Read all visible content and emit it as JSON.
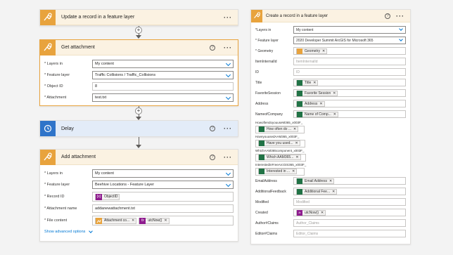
{
  "update_card": {
    "title": "Update a record in a feature layer"
  },
  "get_card": {
    "title": "Get attachment",
    "fields": [
      {
        "label": "* Layers in",
        "value": "My content"
      },
      {
        "label": "* Feature layer",
        "value": "Traffic Collisions / Traffic_Collisions"
      },
      {
        "label": "* Object ID",
        "value": "8"
      },
      {
        "label": "* Attachment",
        "value": "test.txt"
      }
    ]
  },
  "delay_card": {
    "title": "Delay"
  },
  "add_card": {
    "title": "Add attachment",
    "layers_label": "* Layers in",
    "layers_value": "My content",
    "feature_label": "* Feature layer",
    "feature_value": "Beehive Locations - Feature Layer",
    "record_label": "* Record ID",
    "record_token": "ObjectID",
    "name_label": "* Attachment name",
    "name_value": "addanewattachment.txt",
    "content_label": "* File content",
    "content_token1": "Attachment co...",
    "content_token2": "utcNow()",
    "advanced": "Show advanced options"
  },
  "create_card": {
    "title": "Create a record in a feature layer",
    "layers_label": "*Layers in",
    "layers_value": "My content",
    "feature_label": "* Feature layer",
    "feature_value": "2020 Developer Summit ArcGIS for Microsoft 365",
    "geometry_label": "* Geometry",
    "geometry_token": "Geometry",
    "itemid_label": "ItemInternalId",
    "itemid_ph": "ItemInternalId",
    "id_label": "ID",
    "id_ph": "ID",
    "title_label": "Title",
    "title_token": "Title",
    "fav_label": "FavoriteSession",
    "fav_token": "Favorite Session",
    "address_label": "Address",
    "address_token": "Address",
    "company_label": "NameofCompany",
    "company_token": "Name of Comp...",
    "q1_label": "HowoftendoyouuseM365_x003F_",
    "q1_token": "How often do ...",
    "q2_label": "HaveyouusedAAM365_x003F_",
    "q2_token": "Have you used...",
    "q3_label": "WhichAAM365component_x003F_",
    "q3_token": "Which AAM365...",
    "q4_label": "InterestedinFreeArcGIS365_x003F_",
    "q4_token": "Interested in ...",
    "email_label": "EmailAddress",
    "email_token": "Email Address",
    "feedback_label": "AdditionalFeedback",
    "feedback_token": "Additional Fee...",
    "modified_label": "Modified",
    "modified_ph": "Modified",
    "created_label": "Created",
    "created_token": "utcNow()",
    "author_label": "Author#Claims",
    "author_ph": "Author_Claims",
    "editor_label": "Editor#Claims",
    "editor_ph": "Editor_Claims"
  }
}
